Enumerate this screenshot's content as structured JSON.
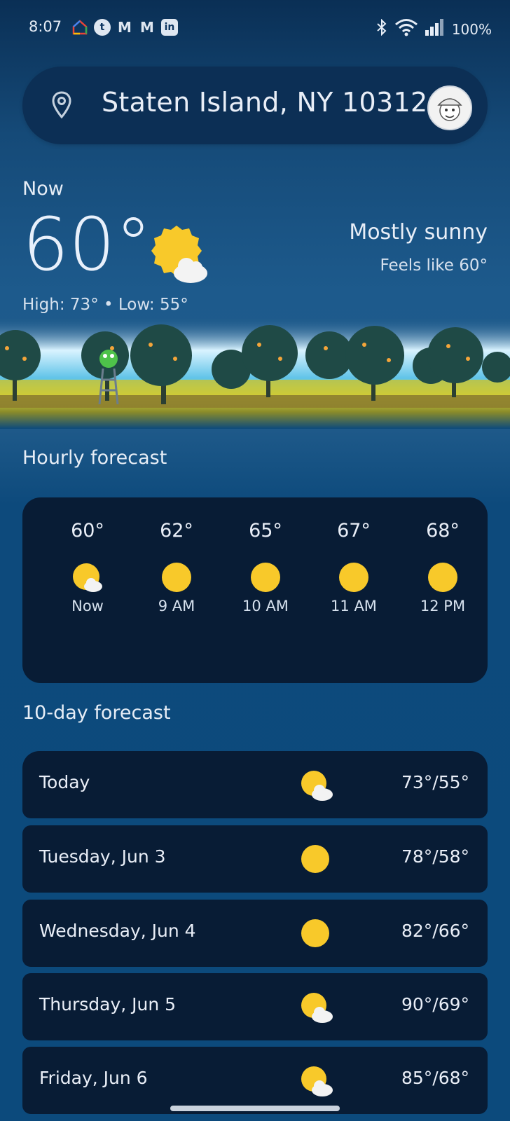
{
  "status": {
    "time": "8:07",
    "battery": "100%"
  },
  "search": {
    "location": "Staten Island, NY 10312"
  },
  "current": {
    "label": "Now",
    "temp": "60°",
    "condition": "Mostly sunny",
    "feels_like": "Feels like 60°",
    "high_low": "High: 73° • Low: 55°"
  },
  "hourly": {
    "title": "Hourly forecast",
    "items": [
      {
        "temp": "60°",
        "label": "Now",
        "icon": "partly-sunny-icon"
      },
      {
        "temp": "62°",
        "label": "9 AM",
        "icon": "sun-icon"
      },
      {
        "temp": "65°",
        "label": "10 AM",
        "icon": "sun-icon"
      },
      {
        "temp": "67°",
        "label": "11 AM",
        "icon": "sun-icon"
      },
      {
        "temp": "68°",
        "label": "12 PM",
        "icon": "sun-icon"
      }
    ]
  },
  "daily": {
    "title": "10-day forecast",
    "items": [
      {
        "day": "Today",
        "temps": "73°/55°",
        "icon": "partly-sunny-icon"
      },
      {
        "day": "Tuesday, Jun 3",
        "temps": "78°/58°",
        "icon": "sun-icon"
      },
      {
        "day": "Wednesday, Jun 4",
        "temps": "82°/66°",
        "icon": "sun-icon"
      },
      {
        "day": "Thursday, Jun 5",
        "temps": "90°/69°",
        "icon": "partly-sunny-icon"
      },
      {
        "day": "Friday, Jun 6",
        "temps": "85°/68°",
        "icon": "partly-sunny-icon"
      }
    ]
  },
  "colors": {
    "sun": "#f8c92a",
    "card": "#081c35",
    "background": "#0c4a7c"
  }
}
